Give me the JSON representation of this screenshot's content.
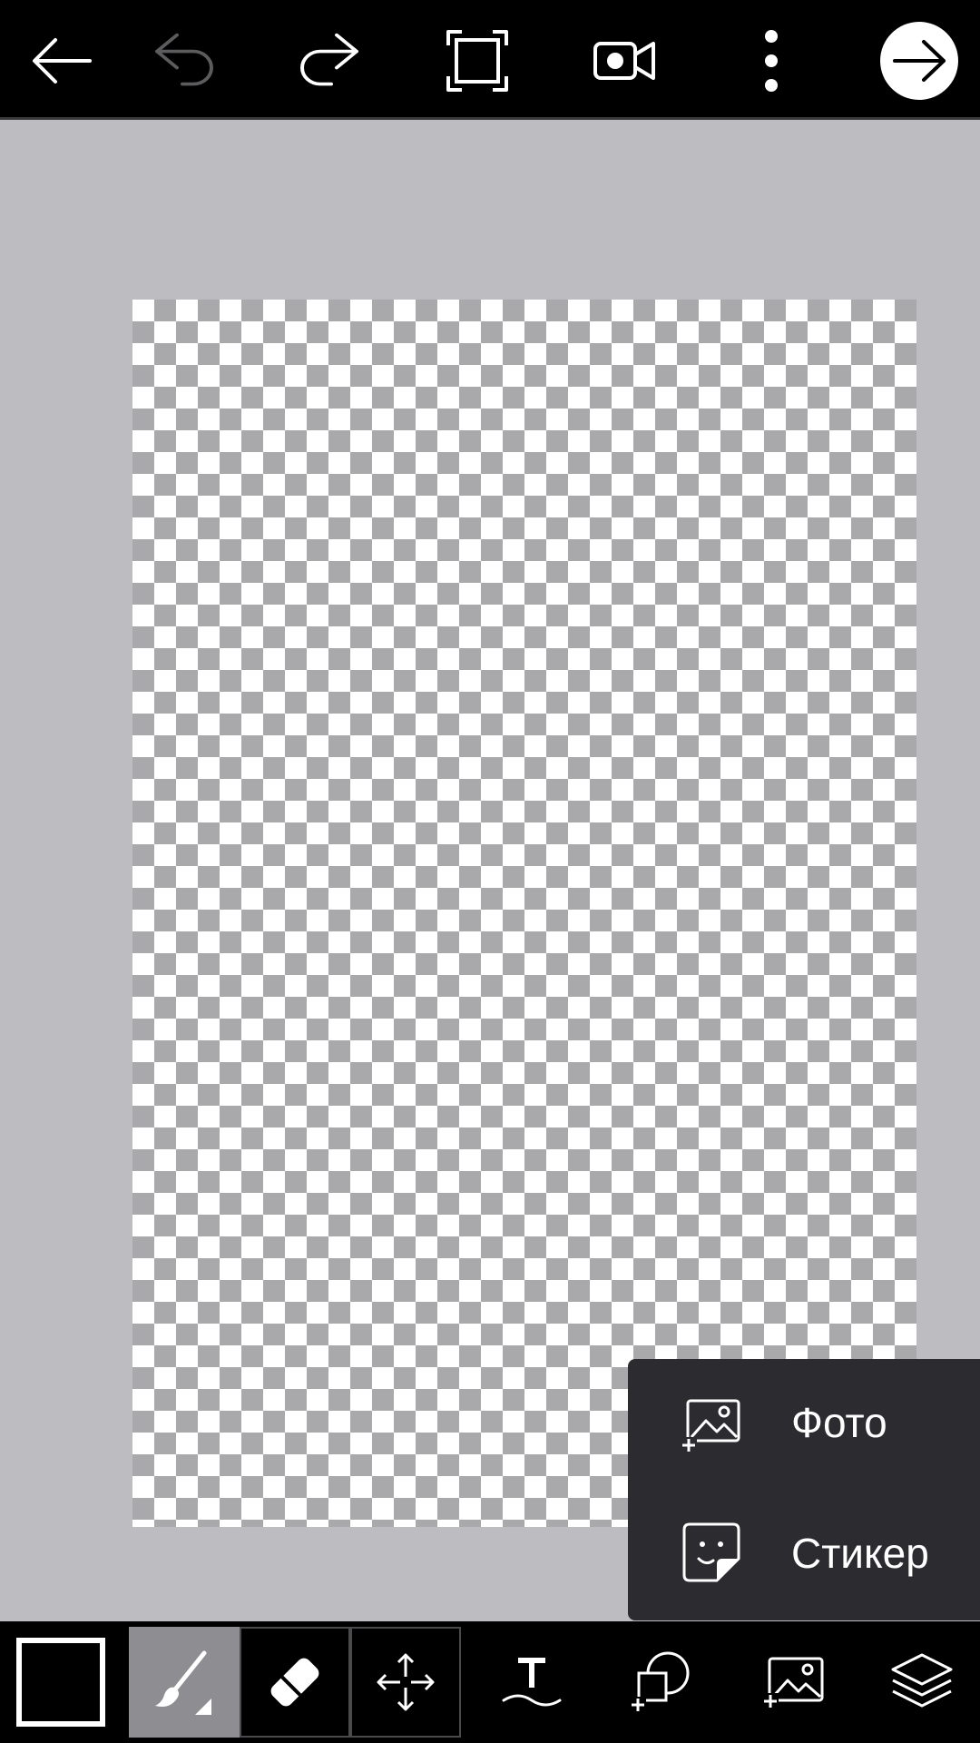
{
  "icons": {
    "back": "arrow-left-icon",
    "undo": "undo-icon",
    "redo": "redo-icon",
    "fullscreen": "fullscreen-icon",
    "record": "video-camera-icon",
    "more": "more-vertical-icon",
    "next": "arrow-right-icon",
    "brush": "brush-icon",
    "eraser": "eraser-icon",
    "move": "move-icon",
    "text": "text-icon",
    "shape": "add-shape-icon",
    "image": "add-image-icon",
    "layers": "layers-icon"
  },
  "colors": {
    "toolbar_bg": "#000000",
    "workspace_bg": "#bdbcc0",
    "menu_bg": "#2c2b2f",
    "active_tool_bg": "#8e8d91",
    "current_color": "#000000",
    "undo_disabled": "#5c5c5e"
  },
  "add_menu": {
    "items": [
      {
        "label": "Фото",
        "icon": "add-photo-icon"
      },
      {
        "label": "Стикер",
        "icon": "sticker-icon"
      }
    ]
  }
}
